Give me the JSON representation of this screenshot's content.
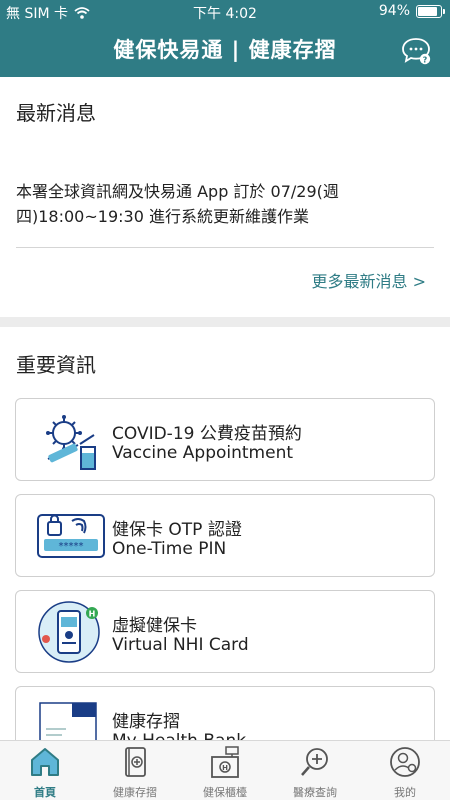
{
  "status": {
    "carrier": "無 SIM 卡",
    "time": "下午 4:02",
    "battery": "94%"
  },
  "appbar": {
    "title": "健保快易通 | 健康存摺"
  },
  "news": {
    "heading": "最新消息",
    "message": "本署全球資訊網及快易通 App 訂於 07/29(週四)18:00~19:30 進行系統更新維護作業",
    "more": "更多最新消息 >"
  },
  "info": {
    "heading": "重要資訊",
    "cards": [
      {
        "title": "COVID-19 公費疫苗預約",
        "subtitle": "Vaccine Appointment",
        "icon": "vaccine-icon"
      },
      {
        "title": "健保卡 OTP 認證",
        "subtitle": "One-Time PIN",
        "icon": "otp-icon"
      },
      {
        "title": "虛擬健保卡",
        "subtitle": "Virtual NHI Card",
        "icon": "virtual-card-icon"
      },
      {
        "title": "健康存摺",
        "subtitle": "My Health Bank",
        "icon": "health-bank-icon"
      }
    ]
  },
  "tabs": [
    {
      "label": "首頁",
      "icon": "home-icon",
      "active": true
    },
    {
      "label": "健康存摺",
      "icon": "health-book-icon",
      "active": false
    },
    {
      "label": "健保櫃檯",
      "icon": "counter-icon",
      "active": false
    },
    {
      "label": "醫療查詢",
      "icon": "medical-search-icon",
      "active": false
    },
    {
      "label": "我的",
      "icon": "profile-icon",
      "active": false
    }
  ],
  "colors": {
    "primary": "#2f7c85",
    "icon_blue": "#1a3d86",
    "background": "#ececec"
  }
}
